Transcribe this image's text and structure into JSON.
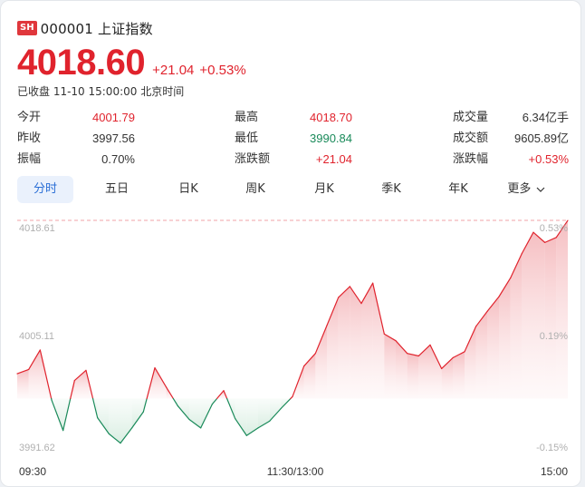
{
  "header": {
    "badge": "SH",
    "title": "000001 上证指数",
    "price": "4018.60",
    "change": "+21.04",
    "change_pct": "+0.53%",
    "status": "已收盘 11-10 15:00:00 北京时间"
  },
  "stats": [
    [
      {
        "k": "今开",
        "v": "4001.79",
        "color": "red"
      },
      {
        "k": "最高",
        "v": "4018.70",
        "color": "red"
      },
      {
        "k": "成交量",
        "v": "6.34亿手",
        "color": "dark"
      }
    ],
    [
      {
        "k": "昨收",
        "v": "3997.56",
        "color": "dark"
      },
      {
        "k": "最低",
        "v": "3990.84",
        "color": "green"
      },
      {
        "k": "成交额",
        "v": "9605.89亿",
        "color": "dark"
      }
    ],
    [
      {
        "k": "振幅",
        "v": "0.70%",
        "color": "dark"
      },
      {
        "k": "涨跌额",
        "v": "+21.04",
        "color": "red"
      },
      {
        "k": "涨跌幅",
        "v": "+0.53%",
        "color": "red"
      }
    ]
  ],
  "tabs": [
    "分时",
    "五日",
    "日K",
    "周K",
    "月K",
    "季K",
    "年K",
    "更多"
  ],
  "active_tab": 0,
  "colors": {
    "up": "#e0232d",
    "down": "#1a8a5a",
    "accent": "#2b6fd6"
  },
  "chart_data": {
    "type": "line",
    "prev_close": 3997.56,
    "y_ticks_left": [
      "4018.61",
      "4005.11",
      "3991.62"
    ],
    "y_ticks_right": [
      "0.53%",
      "0.19%",
      "-0.15%"
    ],
    "x_ticks": [
      "09:30",
      "11:30/13:00",
      "15:00"
    ],
    "ylim": [
      3991.62,
      4018.61
    ],
    "x": [
      "09:30",
      "09:35",
      "09:40",
      "09:45",
      "09:50",
      "09:55",
      "10:00",
      "10:05",
      "10:10",
      "10:15",
      "10:20",
      "10:25",
      "10:30",
      "10:35",
      "10:40",
      "10:45",
      "10:50",
      "10:55",
      "11:00",
      "11:05",
      "11:10",
      "11:15",
      "11:20",
      "11:25",
      "11:30",
      "13:05",
      "13:10",
      "13:15",
      "13:20",
      "13:25",
      "13:30",
      "13:35",
      "13:40",
      "13:45",
      "13:50",
      "13:55",
      "14:00",
      "14:05",
      "14:10",
      "14:15",
      "14:20",
      "14:25",
      "14:30",
      "14:35",
      "14:40",
      "14:45",
      "14:50",
      "14:55",
      "15:00"
    ],
    "values": [
      4000.5,
      4001.0,
      4003.3,
      3997.4,
      3993.8,
      3999.7,
      4000.9,
      3995.3,
      3993.4,
      3992.3,
      3994.1,
      3996.0,
      4001.2,
      3998.9,
      3996.7,
      3995.1,
      3994.1,
      3996.9,
      3998.5,
      3995.2,
      3993.2,
      3994.1,
      3994.9,
      3996.4,
      3997.8,
      4001.4,
      4002.9,
      4006.2,
      4009.5,
      4010.8,
      4008.8,
      4011.2,
      4005.2,
      4004.4,
      4002.9,
      4002.6,
      4003.9,
      4001.1,
      4002.4,
      4003.1,
      4006.1,
      4007.9,
      4009.6,
      4011.8,
      4014.7,
      4017.2,
      4016.0,
      4016.6,
      4018.6
    ]
  }
}
